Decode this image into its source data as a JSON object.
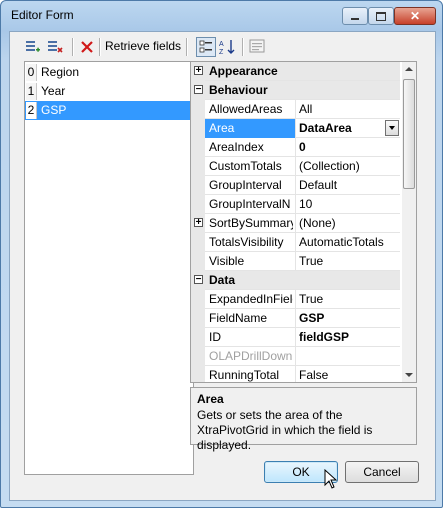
{
  "window": {
    "title": "Editor Form",
    "controls": [
      "minimize-icon",
      "maximize-icon",
      "close-icon"
    ]
  },
  "toolbar": {
    "icons": [
      "add-field-icon",
      "remove-field-icon",
      "delete-icon"
    ],
    "retrieve_label": "Retrieve fields"
  },
  "fields_list": {
    "items": [
      {
        "index": "0",
        "label": "Region"
      },
      {
        "index": "1",
        "label": "Year"
      },
      {
        "index": "2",
        "label": "GSP"
      }
    ],
    "selected_index": 2
  },
  "property_toolbar": {
    "icons": [
      "categorized-icon",
      "alphabetical-sort-icon",
      "property-pages-icon"
    ]
  },
  "properties": {
    "rows": [
      {
        "type": "category",
        "label": "Appearance",
        "expander": "+"
      },
      {
        "type": "category",
        "label": "Behaviour",
        "expander": "−"
      },
      {
        "type": "prop",
        "name": "AllowedAreas",
        "value": "All"
      },
      {
        "type": "prop",
        "name": "Area",
        "value": "DataArea",
        "bold": true,
        "selected": true,
        "dropdown": true
      },
      {
        "type": "prop",
        "name": "AreaIndex",
        "value": "0",
        "bold": true
      },
      {
        "type": "prop",
        "name": "CustomTotals",
        "value": "(Collection)"
      },
      {
        "type": "prop",
        "name": "GroupInterval",
        "value": "Default"
      },
      {
        "type": "prop",
        "name": "GroupIntervalN",
        "value": "10"
      },
      {
        "type": "prop",
        "name": "SortBySummary",
        "value": "(None)",
        "expander": "+"
      },
      {
        "type": "prop",
        "name": "TotalsVisibility",
        "value": "AutomaticTotals"
      },
      {
        "type": "prop",
        "name": "Visible",
        "value": "True"
      },
      {
        "type": "category",
        "label": "Data",
        "expander": "−"
      },
      {
        "type": "prop",
        "name": "ExpandedInFieldsGroup",
        "value": "True"
      },
      {
        "type": "prop",
        "name": "FieldName",
        "value": "GSP",
        "bold": true
      },
      {
        "type": "prop",
        "name": "ID",
        "value": "fieldGSP",
        "bold": true
      },
      {
        "type": "prop",
        "name": "OLAPDrillDownColumnName",
        "value": "",
        "disabled": true
      },
      {
        "type": "prop",
        "name": "RunningTotal",
        "value": "False"
      }
    ]
  },
  "description": {
    "title": "Area",
    "text": "Gets or sets the area of the XtraPivotGrid in which the field is displayed."
  },
  "buttons": {
    "ok_label": "OK",
    "cancel_label": "Cancel"
  }
}
